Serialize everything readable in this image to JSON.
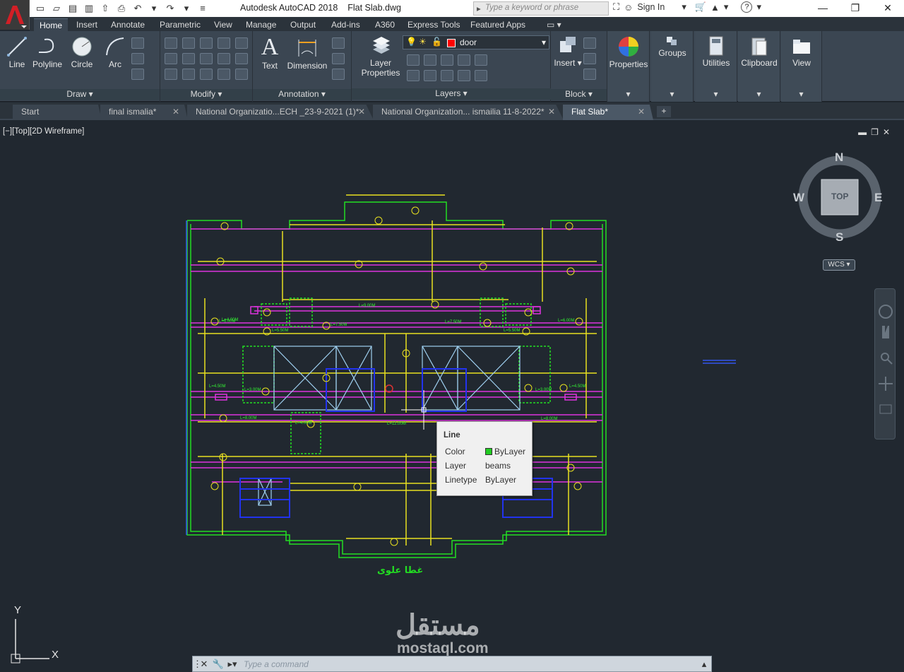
{
  "app": {
    "window_title": "Autodesk AutoCAD 2018",
    "file_name": "Flat Slab.dwg",
    "search_placeholder": "Type a keyword or phrase",
    "sign_in": "Sign In"
  },
  "ribbon_tabs": [
    "Home",
    "Insert",
    "Annotate",
    "Parametric",
    "View",
    "Manage",
    "Output",
    "Add-ins",
    "A360",
    "Express Tools",
    "Featured Apps"
  ],
  "active_ribbon_tab": "Home",
  "panels": {
    "draw": {
      "title": "Draw",
      "buttons": [
        "Line",
        "Polyline",
        "Circle",
        "Arc"
      ]
    },
    "modify": {
      "title": "Modify"
    },
    "annotation": {
      "title": "Annotation",
      "buttons": [
        "Text",
        "Dimension"
      ]
    },
    "layers": {
      "title": "Layers",
      "layer_properties_line1": "Layer",
      "layer_properties_line2": "Properties",
      "current_layer": "door",
      "current_layer_color": "#ff0000"
    },
    "block": {
      "title": "Block",
      "insert": "Insert"
    },
    "properties": {
      "label": "Properties"
    },
    "groups": {
      "label": "Groups"
    },
    "utilities": {
      "label": "Utilities"
    },
    "clipboard": {
      "label": "Clipboard"
    },
    "view": {
      "label": "View"
    }
  },
  "doc_tabs": [
    {
      "label": "Start",
      "active": false,
      "closable": false
    },
    {
      "label": "final ismalia*",
      "active": false,
      "closable": true
    },
    {
      "label": "National Organizatio...ECH _23-9-2021 (1)*",
      "active": false,
      "closable": true
    },
    {
      "label": "National Organization... ismailia 11-8-2022*",
      "active": false,
      "closable": true
    },
    {
      "label": "Flat Slab*",
      "active": true,
      "closable": true
    }
  ],
  "viewport": {
    "label": "[−][Top][2D Wireframe]",
    "viewcube": {
      "top": "TOP",
      "north": "N",
      "south": "S",
      "east": "E",
      "west": "W",
      "wcs": "WCS"
    },
    "drawing_caption": "غطا علوى",
    "ucs_x": "X",
    "ucs_y": "Y"
  },
  "tooltip": {
    "title": "Line",
    "rows": [
      {
        "label": "Color",
        "value": "ByLayer",
        "swatch": "#22cc22"
      },
      {
        "label": "Layer",
        "value": "beams"
      },
      {
        "label": "Linetype",
        "value": "ByLayer"
      }
    ]
  },
  "watermark": {
    "arabic": "مستقل",
    "latin": "mostaql.com"
  },
  "command_line": {
    "placeholder": "Type a command"
  },
  "drawing_labels": {
    "beam_lengths": [
      "L=9.00M",
      "L=4.00M",
      "L=7.50M",
      "L=5.50M",
      "L=6.00M",
      "L=3.00M",
      "L=4.50M",
      "L=12.00M",
      "L=8.00M",
      "L=4.00M",
      "L=7.50M",
      "L=5.50M",
      "L=6.00M",
      "L=3.00M",
      "L=4.50M",
      "L=8.00M"
    ]
  }
}
